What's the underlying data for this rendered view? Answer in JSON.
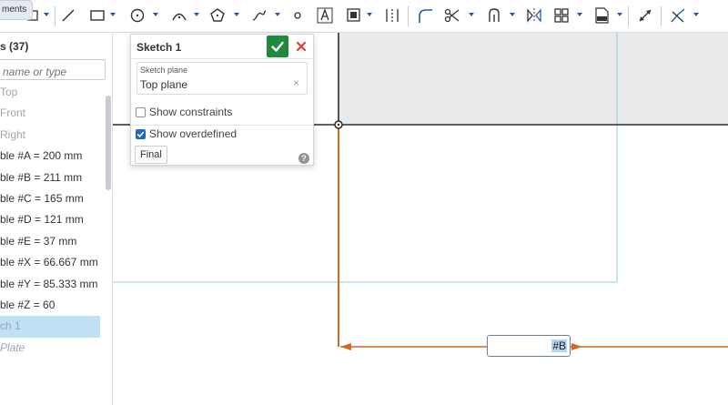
{
  "tab": {
    "label": "ments"
  },
  "toolbar": {
    "icons": [
      "sketch-select-icon",
      "line-icon",
      "rectangle-icon",
      "circle-icon",
      "arc-icon",
      "polygon-icon",
      "spline-icon",
      "point-icon",
      "text-icon",
      "offset-icon",
      "construction-icon",
      "fillet-icon",
      "trim-icon",
      "use-icon",
      "mirror-icon",
      "pattern-icon",
      "dxf-import-icon",
      "dimension-icon",
      "constraint-icon"
    ]
  },
  "features": {
    "header": "s (37)",
    "filter_placeholder": "name or type",
    "items": [
      {
        "label": "Top",
        "state": "dim"
      },
      {
        "label": "Front",
        "state": "dim"
      },
      {
        "label": "Right",
        "state": "dim"
      },
      {
        "label": "ble #A = 200 mm",
        "state": "normal"
      },
      {
        "label": "ble #B = 211 mm",
        "state": "normal"
      },
      {
        "label": "ble #C = 165 mm",
        "state": "normal"
      },
      {
        "label": "ble #D = 121 mm",
        "state": "normal"
      },
      {
        "label": "ble #E = 37 mm",
        "state": "normal"
      },
      {
        "label": "ble #X = 66.667 mm",
        "state": "normal"
      },
      {
        "label": "ble #Y = 85.333 mm",
        "state": "normal"
      },
      {
        "label": "ble #Z = 60",
        "state": "normal"
      },
      {
        "label": "ch 1",
        "state": "selected"
      },
      {
        "label": "Plate",
        "state": "italic"
      }
    ]
  },
  "dialog": {
    "title": "Sketch 1",
    "plane_caption": "Sketch plane",
    "plane_value": "Top plane",
    "plane_clear": "×",
    "show_constraints_label": "Show constraints",
    "show_constraints_checked": false,
    "show_overdefined_label": "Show overdefined",
    "show_overdefined_checked": true,
    "final_label": "Final",
    "help_label": "?"
  },
  "dimension": {
    "value": "#B"
  },
  "colors": {
    "accent_blue": "#2a5aa0",
    "confirm_green": "#1e8a3c",
    "cancel_red": "#d9452c",
    "sketch_orange": "#d2691e",
    "plane_blue": "#8fcbe6",
    "selection": "#bfe0f5"
  }
}
